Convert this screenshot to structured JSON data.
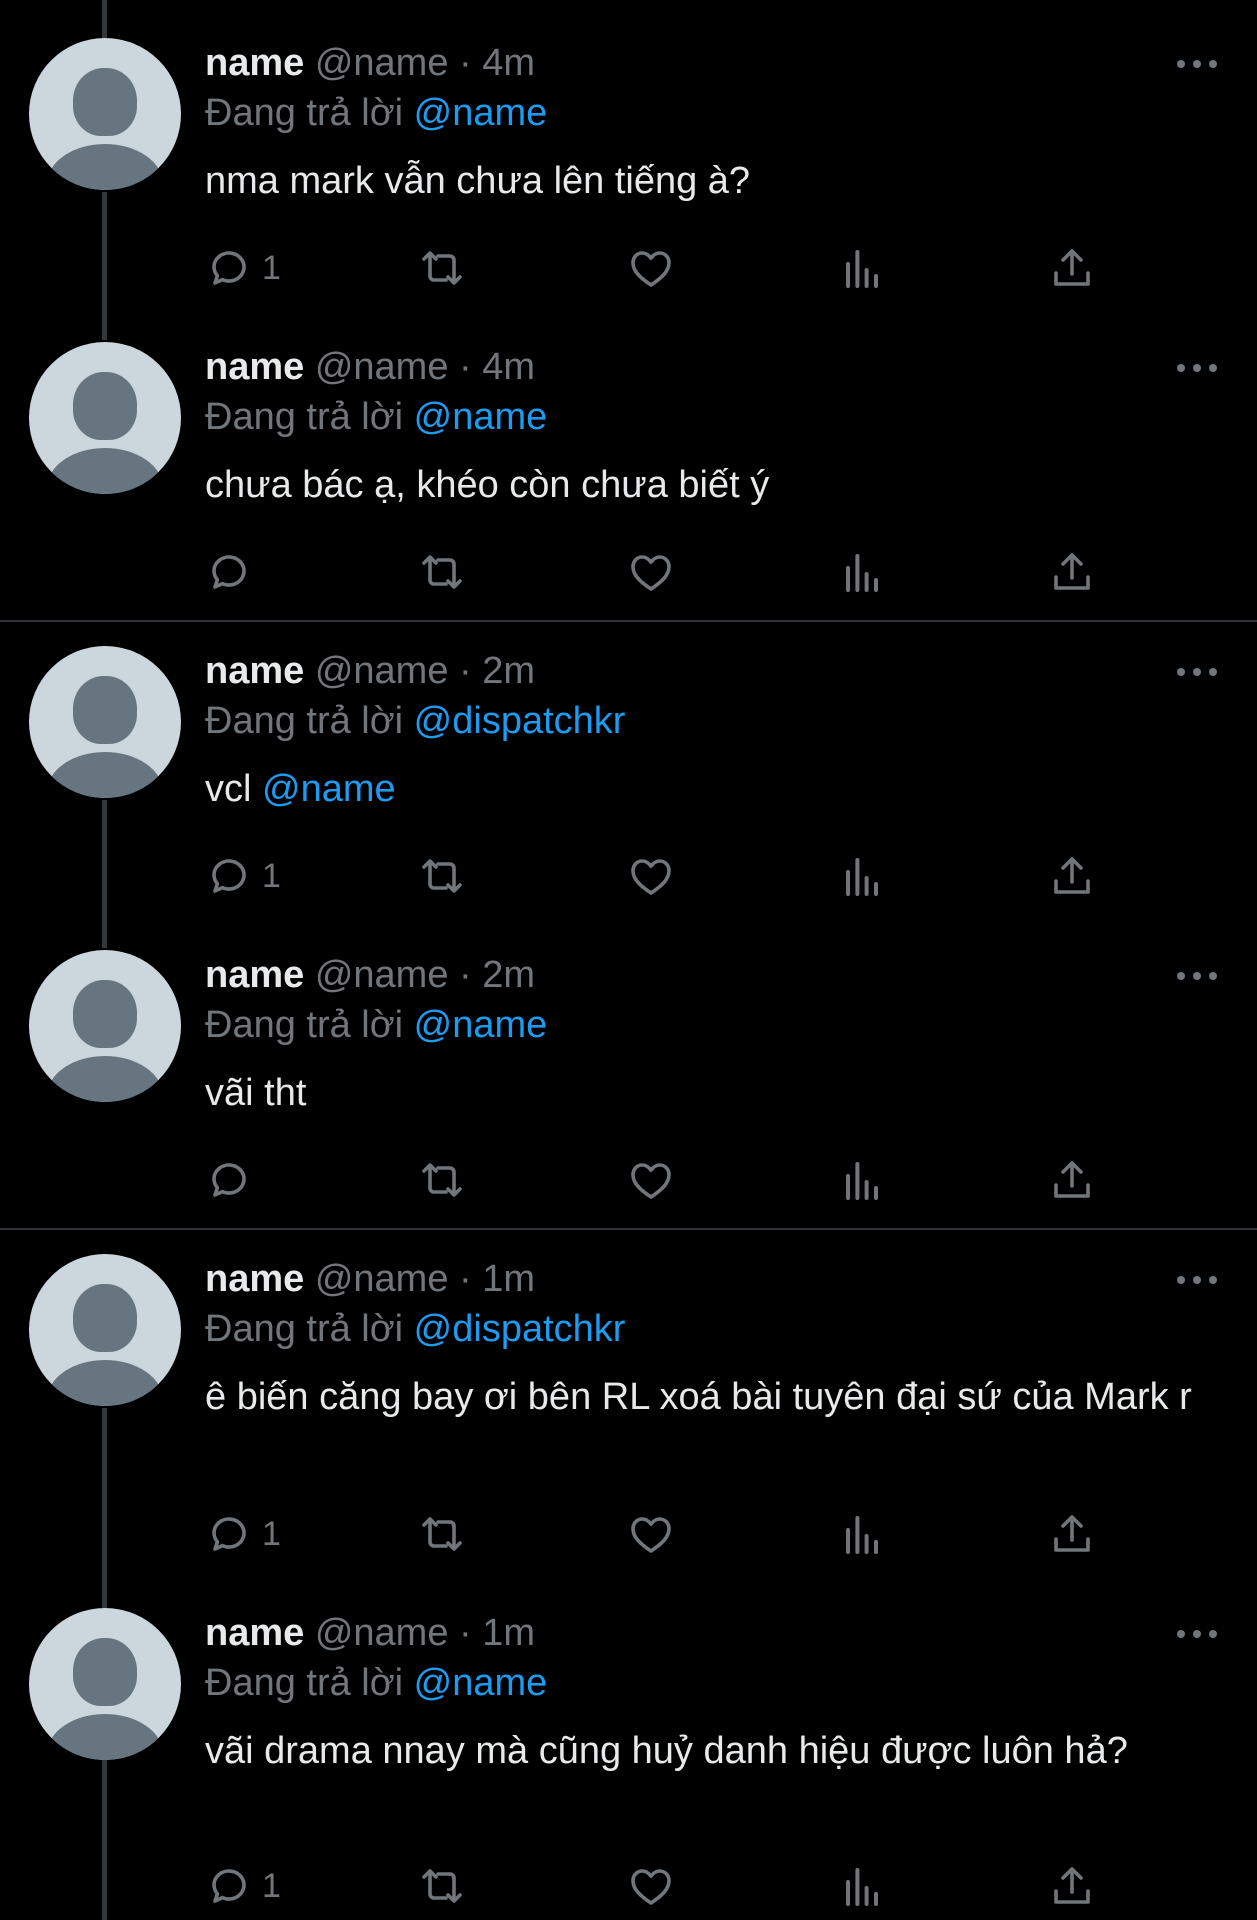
{
  "colors": {
    "background": "#000000",
    "text": "#e7e9ea",
    "muted": "#71767b",
    "mention": "#1d9bf0",
    "divider": "#2f3336"
  },
  "icons": {
    "reply": "reply-icon",
    "retweet": "retweet-icon",
    "like": "like-icon",
    "views": "views-icon",
    "share": "share-icon",
    "more": "more-icon"
  },
  "tweets": [
    {
      "name": "name",
      "handle": "@name",
      "dot": "·",
      "time": "4m",
      "reply_label": "Đang trả lời",
      "reply_to": "@name",
      "text": "nma mark vẫn chưa lên tiếng à?",
      "text_mention": "",
      "reply_count": "1"
    },
    {
      "name": "name",
      "handle": "@name",
      "dot": "·",
      "time": "4m",
      "reply_label": "Đang trả lời",
      "reply_to": "@name",
      "text": "chưa bác ạ, khéo còn chưa biết ý",
      "text_mention": "",
      "reply_count": ""
    },
    {
      "name": "name",
      "handle": "@name",
      "dot": "·",
      "time": "2m",
      "reply_label": "Đang trả lời",
      "reply_to": "@dispatchkr",
      "text": "vcl ",
      "text_mention": "@name",
      "reply_count": "1"
    },
    {
      "name": "name",
      "handle": "@name",
      "dot": "·",
      "time": "2m",
      "reply_label": "Đang trả lời",
      "reply_to": "@name",
      "text": "vãi tht",
      "text_mention": "",
      "reply_count": ""
    },
    {
      "name": "name",
      "handle": "@name",
      "dot": "·",
      "time": "1m",
      "reply_label": "Đang trả lời",
      "reply_to": "@dispatchkr",
      "text": "ê biến căng bay ơi bên RL xoá bài tuyên đại sứ của Mark r",
      "text_mention": "",
      "reply_count": "1"
    },
    {
      "name": "name",
      "handle": "@name",
      "dot": "·",
      "time": "1m",
      "reply_label": "Đang trả lời",
      "reply_to": "@name",
      "text": "vãi drama nnay mà cũng huỷ danh hiệu được luôn hả?",
      "text_mention": "",
      "reply_count": "1"
    }
  ]
}
